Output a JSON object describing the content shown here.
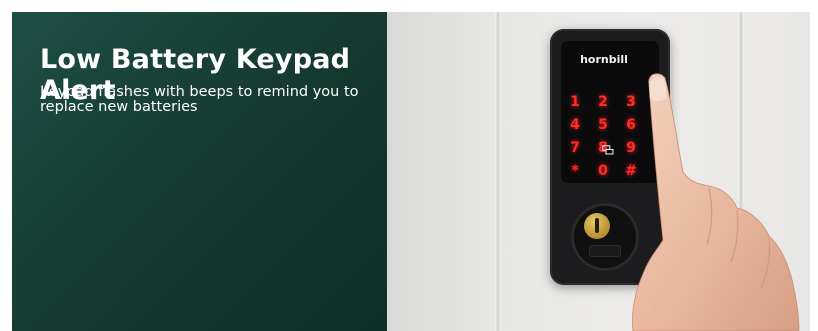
{
  "banner": {
    "title": "Low Battery Keypad Alert",
    "subtitle": "Keypad flashes with beeps to remind you to replace new batteries"
  },
  "lock": {
    "brand": "hornbill",
    "keys": [
      "1",
      "2",
      "3",
      "4",
      "5",
      "6",
      "7",
      "8",
      "9",
      "*",
      "0",
      "#"
    ],
    "key_color": "#ff2a2a"
  },
  "colors": {
    "panel_bg": "#1a4a40",
    "text": "#ffffff",
    "door": "#e6e6e4",
    "lock_body": "#1c1c1e",
    "cylinder": "#c9a23e"
  }
}
